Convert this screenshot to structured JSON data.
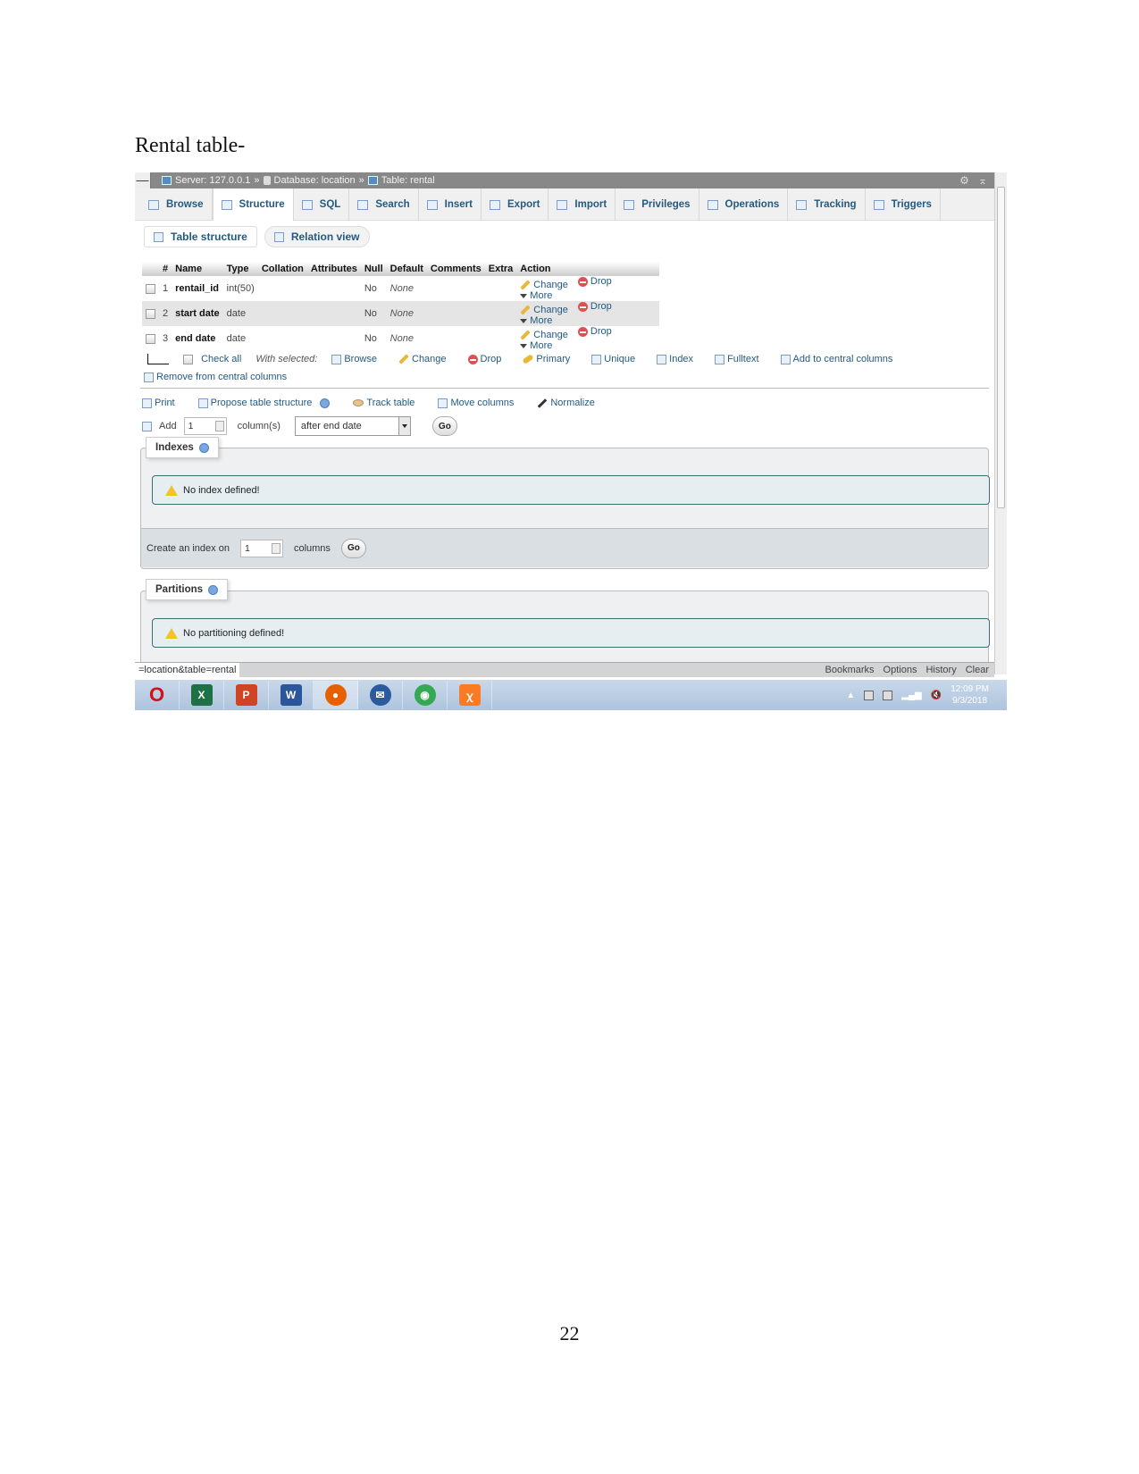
{
  "document": {
    "heading": "Rental table-",
    "page_number": "22"
  },
  "titlebar": {
    "collapse": "—",
    "server": "Server: 127.0.0.1",
    "database": "Database: location",
    "table": "Table: rental",
    "separator": "»"
  },
  "tabs": [
    {
      "label": "Browse",
      "icon": "browse-icon",
      "active": false
    },
    {
      "label": "Structure",
      "icon": "structure-icon",
      "active": true
    },
    {
      "label": "SQL",
      "icon": "sql-icon",
      "active": false
    },
    {
      "label": "Search",
      "icon": "search-icon",
      "active": false
    },
    {
      "label": "Insert",
      "icon": "insert-icon",
      "active": false
    },
    {
      "label": "Export",
      "icon": "export-icon",
      "active": false
    },
    {
      "label": "Import",
      "icon": "import-icon",
      "active": false
    },
    {
      "label": "Privileges",
      "icon": "privileges-icon",
      "active": false
    },
    {
      "label": "Operations",
      "icon": "wrench-icon",
      "active": false
    },
    {
      "label": "Tracking",
      "icon": "eye-icon",
      "active": false
    },
    {
      "label": "Triggers",
      "icon": "triggers-icon",
      "active": false
    }
  ],
  "subtabs": [
    {
      "label": "Table structure"
    },
    {
      "label": "Relation view"
    }
  ],
  "table": {
    "headers": [
      "#",
      "Name",
      "Type",
      "Collation",
      "Attributes",
      "Null",
      "Default",
      "Comments",
      "Extra",
      "Action"
    ],
    "rows": [
      {
        "num": "1",
        "name": "rentail_id",
        "type": "int(50)",
        "collation": "",
        "attributes": "",
        "null": "No",
        "default": "None",
        "comments": "",
        "extra": ""
      },
      {
        "num": "2",
        "name": "start date",
        "type": "date",
        "collation": "",
        "attributes": "",
        "null": "No",
        "default": "None",
        "comments": "",
        "extra": ""
      },
      {
        "num": "3",
        "name": "end date",
        "type": "date",
        "collation": "",
        "attributes": "",
        "null": "No",
        "default": "None",
        "comments": "",
        "extra": ""
      }
    ],
    "actions": {
      "change": "Change",
      "drop": "Drop",
      "more": "More"
    }
  },
  "bulk": {
    "check_all": "Check all",
    "with_selected": "With selected:",
    "actions": [
      "Browse",
      "Change",
      "Drop",
      "Primary",
      "Unique",
      "Index",
      "Fulltext",
      "Add to central columns"
    ],
    "remove_central": "Remove from central columns"
  },
  "tools": {
    "print": "Print",
    "propose": "Propose table structure",
    "track": "Track table",
    "move": "Move columns",
    "normalize": "Normalize"
  },
  "add_columns": {
    "label": "Add",
    "count": "1",
    "unit": "column(s)",
    "position": "after end date",
    "go": "Go"
  },
  "indexes": {
    "legend": "Indexes",
    "notice": "No index defined!",
    "create_label": "Create an index on",
    "create_count": "1",
    "create_unit": "columns",
    "go": "Go"
  },
  "partitions": {
    "legend": "Partitions",
    "notice": "No partitioning defined!"
  },
  "statusbar": {
    "url": "=location&table=rental",
    "links": [
      "Bookmarks",
      "Options",
      "History",
      "Clear"
    ]
  },
  "taskbar": {
    "apps": [
      {
        "name": "opera",
        "glyph": "O",
        "color": "#d0121a"
      },
      {
        "name": "excel",
        "glyph": "X",
        "color": "#1e7145"
      },
      {
        "name": "powerpoint",
        "glyph": "P",
        "color": "#d04423"
      },
      {
        "name": "word",
        "glyph": "W",
        "color": "#2b579a"
      },
      {
        "name": "firefox",
        "glyph": "●",
        "color": "#e66000"
      },
      {
        "name": "thunderbird",
        "glyph": "✉",
        "color": "#2a5b9c"
      },
      {
        "name": "chrome",
        "glyph": "◉",
        "color": "#34a853"
      },
      {
        "name": "xampp",
        "glyph": "ꭓ",
        "color": "#fb7a24"
      }
    ],
    "time": "12:09 PM",
    "date": "9/3/2018"
  }
}
